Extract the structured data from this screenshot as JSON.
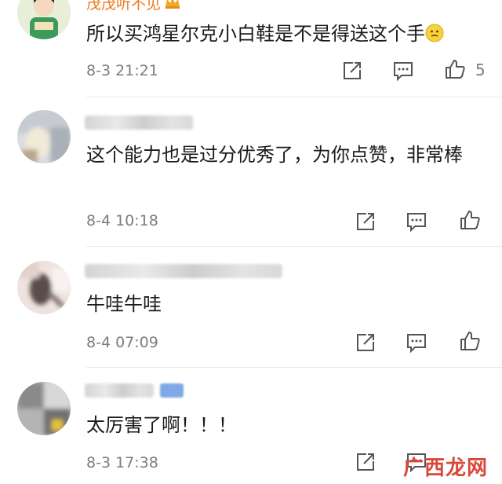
{
  "comments": [
    {
      "username": "茂茂听不见",
      "username_visible": true,
      "text": "所以买鸿星尔克小白鞋是不是得送这个手",
      "emoji_icon": "thinking-face-emoji",
      "time": "8-3 21:21",
      "likes": "5"
    },
    {
      "username_visible": false,
      "text": "这个能力也是过分优秀了，为你点赞，非常棒",
      "time": "8-4 10:18",
      "likes": ""
    },
    {
      "username_visible": false,
      "text": "牛哇牛哇",
      "time": "8-4 07:09",
      "likes": ""
    },
    {
      "username_visible": false,
      "text": "太厉害了啊！！！",
      "time": "8-3 17:38",
      "likes": ""
    }
  ],
  "icons": {
    "share": "share-icon",
    "comment": "comment-icon",
    "like": "thumbs-up-icon"
  },
  "watermark": "广西龙网",
  "colors": {
    "username": "#eb7b1e",
    "text": "#1a1a1a",
    "meta": "#7d7d7d",
    "watermark": "#d8483a"
  }
}
